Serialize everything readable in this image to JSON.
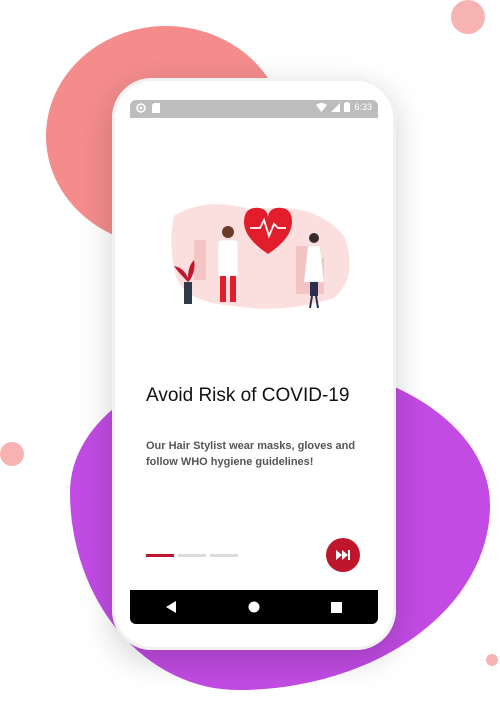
{
  "status_bar": {
    "time": "6:33"
  },
  "onboarding": {
    "title": "Avoid Risk of COVID-19",
    "subtitle": "Our Hair Stylist wear masks, gloves and follow WHO hygiene guidelines!",
    "page_index": 1,
    "page_count": 3
  },
  "navigation": {
    "icons": [
      "back-icon",
      "home-icon",
      "recents-icon"
    ]
  },
  "colors": {
    "accent": "#c0162b",
    "blob_red": "#f48c8c",
    "blob_purple": "#c14be3",
    "status_bar": "#bdbdbd"
  }
}
